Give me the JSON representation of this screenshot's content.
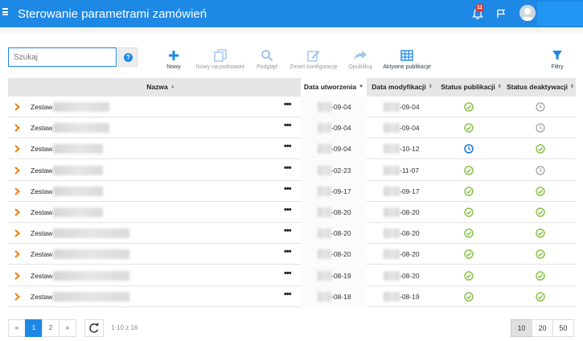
{
  "header": {
    "title": "Sterowanie parametrami zamówień",
    "notifications_count": "11",
    "icons": [
      "menu-icon",
      "bell-icon",
      "flag-icon",
      "user-avatar-icon"
    ]
  },
  "search": {
    "placeholder": "Szukaj",
    "value": "",
    "help_label": "?"
  },
  "toolbar": {
    "new": "Nowy",
    "new_based": "Nowy na podstawie",
    "preview": "Podgląd",
    "change_config": "Zmień konfigurację",
    "publish": "Opublikuj",
    "active_publications": "Aktywne publikacje",
    "filters": "Filtry"
  },
  "table": {
    "columns": {
      "name": "Nazwa",
      "created": "Data utworzenia",
      "modified": "Data modyfikacji",
      "pub_status": "Status publikacji",
      "deact_status": "Status deaktywacji"
    },
    "more_label": "•••",
    "rows": [
      {
        "name": "Zestaw",
        "created": "-09-04",
        "modified": "-09-04",
        "pub": "ok",
        "deact": "pending"
      },
      {
        "name": "Zestaw",
        "created": "-09-04",
        "modified": "-09-04",
        "pub": "ok",
        "deact": "pending"
      },
      {
        "name": "Zestaw",
        "created": "-09-04",
        "modified": "-10-12",
        "pub": "scheduled",
        "deact": "ok"
      },
      {
        "name": "Zestaw",
        "created": "-02-23",
        "modified": "-11-07",
        "pub": "ok",
        "deact": "pending"
      },
      {
        "name": "Zestaw",
        "created": "-09-17",
        "modified": "-09-17",
        "pub": "ok",
        "deact": "ok"
      },
      {
        "name": "Zestaw",
        "created": "-08-20",
        "modified": "-08-20",
        "pub": "ok",
        "deact": "ok"
      },
      {
        "name": "Zestaw",
        "created": "-08-20",
        "modified": "-08-20",
        "pub": "ok",
        "deact": "ok"
      },
      {
        "name": "Zestaw",
        "created": "-08-20",
        "modified": "-08-20",
        "pub": "ok",
        "deact": "ok"
      },
      {
        "name": "Zestaw",
        "created": "-08-19",
        "modified": "-08-20",
        "pub": "ok",
        "deact": "ok"
      },
      {
        "name": "Zestaw",
        "created": "-08-18",
        "modified": "-08-19",
        "pub": "ok",
        "deact": "ok"
      }
    ]
  },
  "pagination": {
    "prev": "«",
    "pages": [
      "1",
      "2"
    ],
    "next": "»",
    "current": "1",
    "range_text": "1-10 z 16",
    "page_sizes": [
      "10",
      "20",
      "50"
    ],
    "selected_size": "10"
  },
  "colors": {
    "accent": "#1e88e5",
    "ok": "#8bc34a",
    "scheduled": "#1976d2",
    "pending": "#9e9e9e",
    "chevron": "#f57c00"
  }
}
